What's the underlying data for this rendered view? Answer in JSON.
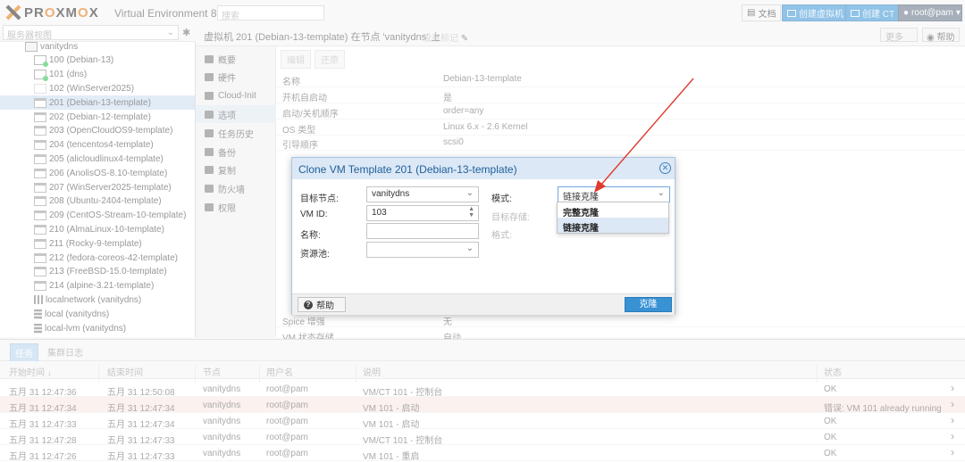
{
  "topbar": {
    "logo": "PROXMOX",
    "version": "Virtual Environment 8.4.1",
    "search_placeholder": "搜索",
    "docs": "文档",
    "create_vm": "创建虚拟机",
    "create_ct": "创建 CT",
    "user": "root@pam"
  },
  "tree": {
    "view_select": "服务器视图",
    "items": [
      {
        "label": "vanitydns",
        "kind": "node"
      },
      {
        "label": "100 (Debian-13)",
        "kind": "vm-run"
      },
      {
        "label": "101 (dns)",
        "kind": "vm-run"
      },
      {
        "label": "102 (WinServer2025)",
        "kind": "vm-off"
      },
      {
        "label": "201 (Debian-13-template)",
        "kind": "tpl"
      },
      {
        "label": "202 (Debian-12-template)",
        "kind": "tpl"
      },
      {
        "label": "203 (OpenCloudOS9-template)",
        "kind": "tpl"
      },
      {
        "label": "204 (tencentos4-template)",
        "kind": "tpl"
      },
      {
        "label": "205 (alicloudlinux4-template)",
        "kind": "tpl"
      },
      {
        "label": "206 (AnolisOS-8.10-template)",
        "kind": "tpl"
      },
      {
        "label": "207 (WinServer2025-template)",
        "kind": "tpl"
      },
      {
        "label": "208 (Ubuntu-2404-template)",
        "kind": "tpl"
      },
      {
        "label": "209 (CentOS-Stream-10-template)",
        "kind": "tpl"
      },
      {
        "label": "210 (AlmaLinux-10-template)",
        "kind": "tpl"
      },
      {
        "label": "211 (Rocky-9-template)",
        "kind": "tpl"
      },
      {
        "label": "212 (fedora-coreos-42-template)",
        "kind": "tpl"
      },
      {
        "label": "213 (FreeBSD-15.0-template)",
        "kind": "tpl"
      },
      {
        "label": "214 (alpine-3.21-template)",
        "kind": "tpl"
      },
      {
        "label": "localnetwork (vanitydns)",
        "kind": "net"
      },
      {
        "label": "local (vanitydns)",
        "kind": "store"
      },
      {
        "label": "local-lvm (vanitydns)",
        "kind": "store"
      }
    ]
  },
  "main": {
    "title": "虚拟机 201 (Debian-13-template) 在节点 'vanitydns' 上",
    "note": "没有标记",
    "more": "更多",
    "help": "帮助",
    "toolbar": {
      "edit": "编辑",
      "revert": "还原"
    },
    "subnav": [
      "概要",
      "硬件",
      "Cloud-Init",
      "选项",
      "任务历史",
      "备份",
      "复制",
      "防火墙",
      "权限"
    ],
    "props": [
      {
        "k": "名称",
        "v": "Debian-13-template"
      },
      {
        "k": "开机自启动",
        "v": "是"
      },
      {
        "k": "启动/关机顺序",
        "v": "order=any"
      },
      {
        "k": "OS 类型",
        "v": "Linux 6.x - 2.6 Kernel"
      },
      {
        "k": "引导顺序",
        "v": "scsi0"
      },
      {
        "k": "Spice 增强",
        "v": "无"
      },
      {
        "k": "VM 状态存储",
        "v": "自动"
      }
    ]
  },
  "dialog": {
    "title": "Clone VM Template 201 (Debian-13-template)",
    "target_node_label": "目标节点:",
    "target_node": "vanitydns",
    "vmid_label": "VM ID:",
    "vmid": "103",
    "name_label": "名称:",
    "pool_label": "资源池:",
    "mode_label": "模式:",
    "mode": "链接克隆",
    "target_storage_label": "目标存储:",
    "format_label": "格式:",
    "help": "帮助",
    "clone": "克隆",
    "options": [
      "完整克隆",
      "链接克隆"
    ]
  },
  "bottom": {
    "tabs": [
      "任务",
      "集群日志"
    ],
    "headers": [
      "开始时间 ↓",
      "结束时间",
      "节点",
      "用户名",
      "说明",
      "状态"
    ],
    "rows": [
      {
        "start": "五月 31 12:47:36",
        "end": "五月 31 12:50:08",
        "node": "vanitydns",
        "user": "root@pam",
        "desc": "VM/CT 101 - 控制台",
        "status": "OK"
      },
      {
        "start": "五月 31 12:47:34",
        "end": "五月 31 12:47:34",
        "node": "vanitydns",
        "user": "root@pam",
        "desc": "VM 101 - 启动",
        "status": "错误: VM 101 already running"
      },
      {
        "start": "五月 31 12:47:33",
        "end": "五月 31 12:47:34",
        "node": "vanitydns",
        "user": "root@pam",
        "desc": "VM 101 - 启动",
        "status": "OK"
      },
      {
        "start": "五月 31 12:47:28",
        "end": "五月 31 12:47:33",
        "node": "vanitydns",
        "user": "root@pam",
        "desc": "VM/CT 101 - 控制台",
        "status": "OK"
      },
      {
        "start": "五月 31 12:47:26",
        "end": "五月 31 12:47:33",
        "node": "vanitydns",
        "user": "root@pam",
        "desc": "VM 101 - 重启",
        "status": "OK"
      }
    ]
  },
  "colors": {
    "accent": "#3892d4",
    "brand": "#e57000",
    "annotation": "#e03a2f"
  }
}
